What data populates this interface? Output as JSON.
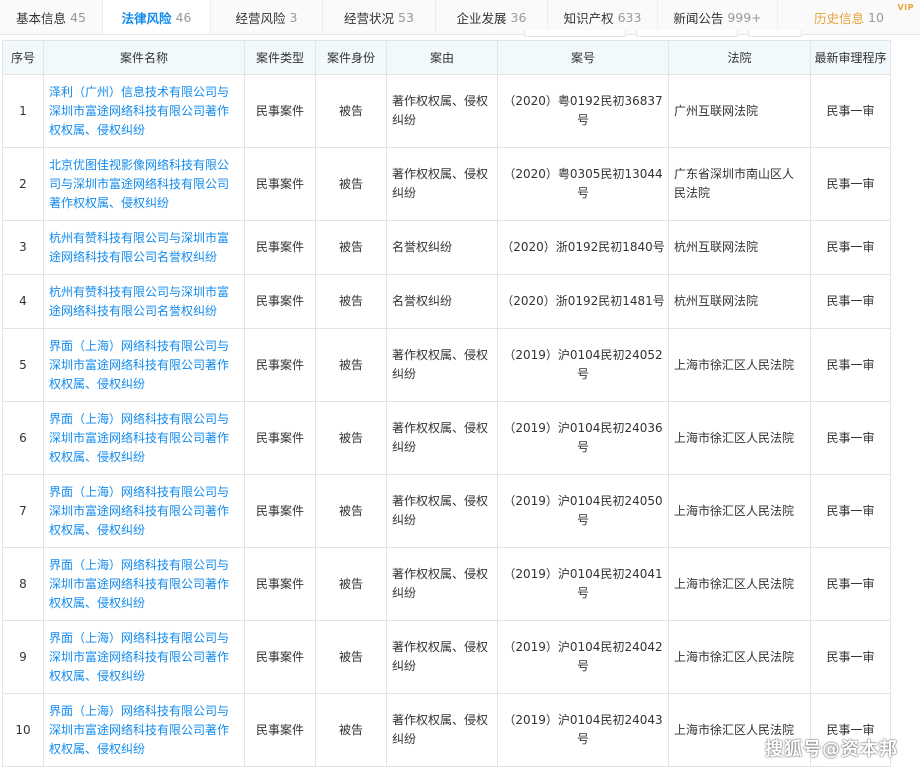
{
  "colors": {
    "accent": "#128bed",
    "history": "#e8a33b",
    "header_bg": "#f2f9fc"
  },
  "tabs": [
    {
      "label": "基本信息",
      "count": "45"
    },
    {
      "label": "法律风险",
      "count": "46"
    },
    {
      "label": "经营风险",
      "count": "3"
    },
    {
      "label": "经营状况",
      "count": "53"
    },
    {
      "label": "企业发展",
      "count": "36"
    },
    {
      "label": "知识产权",
      "count": "633"
    },
    {
      "label": "新闻公告",
      "count": "999+"
    },
    {
      "label": "历史信息",
      "count": "10",
      "badge": "VIP"
    }
  ],
  "table": {
    "headers": [
      "序号",
      "案件名称",
      "案件类型",
      "案件身份",
      "案由",
      "案号",
      "法院",
      "最新审理程序"
    ],
    "rows": [
      {
        "idx": "1",
        "name": "泽利（广州）信息技术有限公司与深圳市富途网络科技有限公司著作权权属、侵权纠纷",
        "type": "民事案件",
        "role": "被告",
        "cause": "著作权权属、侵权纠纷",
        "caseno": "（2020）粤0192民初36837号",
        "court": "广州互联网法院",
        "stage": "民事一审"
      },
      {
        "idx": "2",
        "name": "北京优图佳视影像网络科技有限公司与深圳市富途网络科技有限公司著作权权属、侵权纠纷",
        "type": "民事案件",
        "role": "被告",
        "cause": "著作权权属、侵权纠纷",
        "caseno": "（2020）粤0305民初13044号",
        "court": "广东省深圳市南山区人民法院",
        "stage": "民事一审"
      },
      {
        "idx": "3",
        "name": "杭州有赞科技有限公司与深圳市富途网络科技有限公司名誉权纠纷",
        "type": "民事案件",
        "role": "被告",
        "cause": "名誉权纠纷",
        "caseno": "（2020）浙0192民初1840号",
        "court": "杭州互联网法院",
        "stage": "民事一审"
      },
      {
        "idx": "4",
        "name": "杭州有赞科技有限公司与深圳市富途网络科技有限公司名誉权纠纷",
        "type": "民事案件",
        "role": "被告",
        "cause": "名誉权纠纷",
        "caseno": "（2020）浙0192民初1481号",
        "court": "杭州互联网法院",
        "stage": "民事一审"
      },
      {
        "idx": "5",
        "name": "界面（上海）网络科技有限公司与深圳市富途网络科技有限公司著作权权属、侵权纠纷",
        "type": "民事案件",
        "role": "被告",
        "cause": "著作权权属、侵权纠纷",
        "caseno": "（2019）沪0104民初24052号",
        "court": "上海市徐汇区人民法院",
        "stage": "民事一审"
      },
      {
        "idx": "6",
        "name": "界面（上海）网络科技有限公司与深圳市富途网络科技有限公司著作权权属、侵权纠纷",
        "type": "民事案件",
        "role": "被告",
        "cause": "著作权权属、侵权纠纷",
        "caseno": "（2019）沪0104民初24036号",
        "court": "上海市徐汇区人民法院",
        "stage": "民事一审"
      },
      {
        "idx": "7",
        "name": "界面（上海）网络科技有限公司与深圳市富途网络科技有限公司著作权权属、侵权纠纷",
        "type": "民事案件",
        "role": "被告",
        "cause": "著作权权属、侵权纠纷",
        "caseno": "（2019）沪0104民初24050号",
        "court": "上海市徐汇区人民法院",
        "stage": "民事一审"
      },
      {
        "idx": "8",
        "name": "界面（上海）网络科技有限公司与深圳市富途网络科技有限公司著作权权属、侵权纠纷",
        "type": "民事案件",
        "role": "被告",
        "cause": "著作权权属、侵权纠纷",
        "caseno": "（2019）沪0104民初24041号",
        "court": "上海市徐汇区人民法院",
        "stage": "民事一审"
      },
      {
        "idx": "9",
        "name": "界面（上海）网络科技有限公司与深圳市富途网络科技有限公司著作权权属、侵权纠纷",
        "type": "民事案件",
        "role": "被告",
        "cause": "著作权权属、侵权纠纷",
        "caseno": "（2019）沪0104民初24042号",
        "court": "上海市徐汇区人民法院",
        "stage": "民事一审"
      },
      {
        "idx": "10",
        "name": "界面（上海）网络科技有限公司与深圳市富途网络科技有限公司著作权权属、侵权纠纷",
        "type": "民事案件",
        "role": "被告",
        "cause": "著作权权属、侵权纠纷",
        "caseno": "（2019）沪0104民初24043号",
        "court": "上海市徐汇区人民法院",
        "stage": "民事一审"
      }
    ]
  },
  "watermark": "搜狐号@资本邦"
}
